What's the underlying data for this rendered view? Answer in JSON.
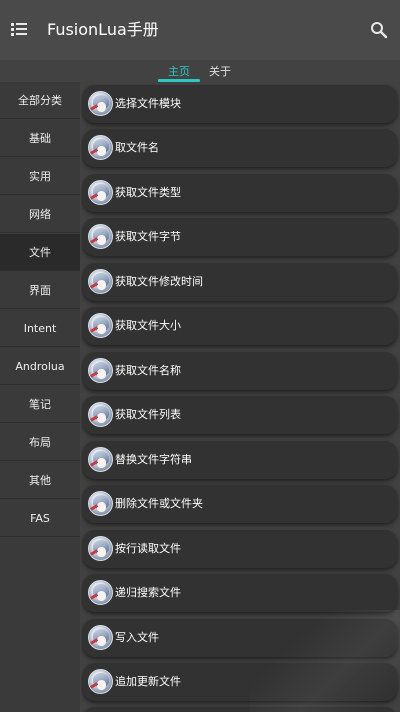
{
  "header": {
    "title": "FusionLua手册",
    "menu_icon": "menu-icon",
    "search_icon": "search-icon"
  },
  "tabs": [
    {
      "label": "主页",
      "active": true
    },
    {
      "label": "关于",
      "active": false
    }
  ],
  "colors": {
    "accent": "#2ec7c2",
    "background": "#424242",
    "card": "#323232",
    "sidebar": "#3a3a3a"
  },
  "sidebar": {
    "items": [
      {
        "label": "全部分类"
      },
      {
        "label": "基础"
      },
      {
        "label": "实用"
      },
      {
        "label": "网络"
      },
      {
        "label": "文件",
        "active": true
      },
      {
        "label": "界面"
      },
      {
        "label": "Intent"
      },
      {
        "label": "Androlua"
      },
      {
        "label": "笔记"
      },
      {
        "label": "布局"
      },
      {
        "label": "其他"
      },
      {
        "label": "FAS"
      }
    ]
  },
  "list": {
    "items": [
      {
        "label": "选择文件模块"
      },
      {
        "label": "取文件名"
      },
      {
        "label": "获取文件类型"
      },
      {
        "label": "获取文件字节"
      },
      {
        "label": "获取文件修改时间"
      },
      {
        "label": "获取文件大小"
      },
      {
        "label": "获取文件名称"
      },
      {
        "label": "获取文件列表"
      },
      {
        "label": "替换文件字符串"
      },
      {
        "label": "删除文件或文件夹"
      },
      {
        "label": "按行读取文件"
      },
      {
        "label": "递归搜索文件"
      },
      {
        "label": "写入文件"
      },
      {
        "label": "追加更新文件"
      }
    ]
  }
}
